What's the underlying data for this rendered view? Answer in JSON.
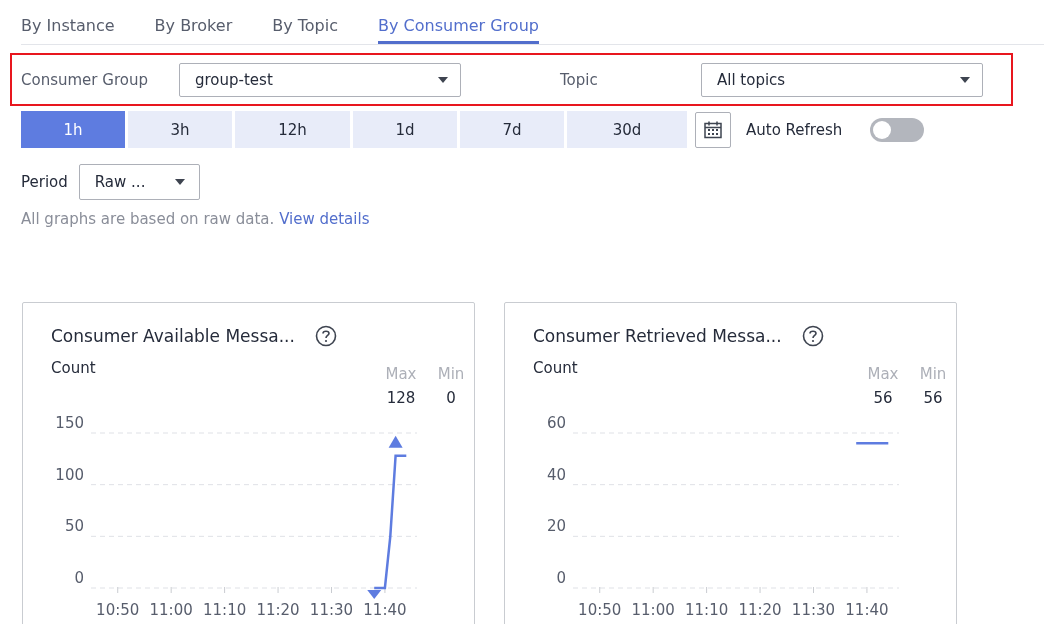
{
  "tabs": [
    {
      "label": "By Instance",
      "selected": false
    },
    {
      "label": "By Broker",
      "selected": false
    },
    {
      "label": "By Topic",
      "selected": false
    },
    {
      "label": "By Consumer Group",
      "selected": true
    }
  ],
  "filters": [
    {
      "label": "Consumer Group",
      "value": "group-test"
    },
    {
      "label": "Topic",
      "value": "All topics"
    }
  ],
  "time_ranges": [
    {
      "label": "1h",
      "selected": true
    },
    {
      "label": "3h",
      "selected": false
    },
    {
      "label": "12h",
      "selected": false
    },
    {
      "label": "1d",
      "selected": false
    },
    {
      "label": "7d",
      "selected": false
    },
    {
      "label": "30d",
      "selected": false
    }
  ],
  "auto_refresh": {
    "label": "Auto Refresh",
    "on": false
  },
  "period": {
    "label": "Period",
    "value": "Raw ..."
  },
  "info": {
    "text": "All graphs are based on raw data.",
    "link": "View details"
  },
  "cards": [
    {
      "title": "Consumer Available Messa...",
      "ylabel": "Count",
      "stats": [
        {
          "label": "Max",
          "value": "128"
        },
        {
          "label": "Min",
          "value": "0"
        }
      ],
      "show_extremes": true,
      "chart_data": {
        "type": "line",
        "categories": [
          "10:50",
          null,
          null,
          null,
          null,
          null,
          null,
          null,
          null,
          null,
          "11:00",
          null,
          null,
          null,
          null,
          null,
          null,
          null,
          null,
          null,
          "11:10",
          null,
          null,
          null,
          null,
          null,
          null,
          null,
          null,
          null,
          "11:20",
          null,
          null,
          null,
          null,
          null,
          null,
          null,
          null,
          null,
          "11:30",
          null,
          null,
          null,
          null,
          null,
          null,
          null,
          null,
          null,
          "11:40",
          null,
          null,
          null,
          null
        ],
        "series": [
          {
            "color": "#5e7ce0",
            "values": [
              null,
              null,
              null,
              null,
              null,
              null,
              null,
              null,
              null,
              null,
              null,
              null,
              null,
              null,
              null,
              null,
              null,
              null,
              null,
              null,
              null,
              null,
              null,
              null,
              null,
              null,
              null,
              null,
              null,
              null,
              null,
              null,
              null,
              null,
              null,
              null,
              null,
              null,
              null,
              null,
              null,
              null,
              null,
              null,
              null,
              null,
              null,
              null,
              0,
              0,
              0,
              50,
              128,
              128,
              128
            ]
          }
        ],
        "ylim": [
          0,
          150
        ],
        "yticks": [
          0,
          50,
          100,
          150
        ]
      }
    },
    {
      "title": "Consumer Retrieved Messa...",
      "ylabel": "Count",
      "stats": [
        {
          "label": "Max",
          "value": "56"
        },
        {
          "label": "Min",
          "value": "56"
        }
      ],
      "show_extremes": false,
      "chart_data": {
        "type": "line",
        "categories": [
          "10:50",
          null,
          null,
          null,
          null,
          null,
          null,
          null,
          null,
          null,
          "11:00",
          null,
          null,
          null,
          null,
          null,
          null,
          null,
          null,
          null,
          "11:10",
          null,
          null,
          null,
          null,
          null,
          null,
          null,
          null,
          null,
          "11:20",
          null,
          null,
          null,
          null,
          null,
          null,
          null,
          null,
          null,
          "11:30",
          null,
          null,
          null,
          null,
          null,
          null,
          null,
          null,
          null,
          "11:40",
          null,
          null,
          null,
          null
        ],
        "series": [
          {
            "color": "#5e7ce0",
            "values": [
              null,
              null,
              null,
              null,
              null,
              null,
              null,
              null,
              null,
              null,
              null,
              null,
              null,
              null,
              null,
              null,
              null,
              null,
              null,
              null,
              null,
              null,
              null,
              null,
              null,
              null,
              null,
              null,
              null,
              null,
              null,
              null,
              null,
              null,
              null,
              null,
              null,
              null,
              null,
              null,
              null,
              null,
              null,
              null,
              null,
              null,
              null,
              null,
              56,
              56,
              56,
              56,
              56,
              56,
              56
            ]
          }
        ],
        "ylim": [
          0,
          60
        ],
        "yticks": [
          0,
          20,
          40,
          60
        ]
      }
    }
  ]
}
